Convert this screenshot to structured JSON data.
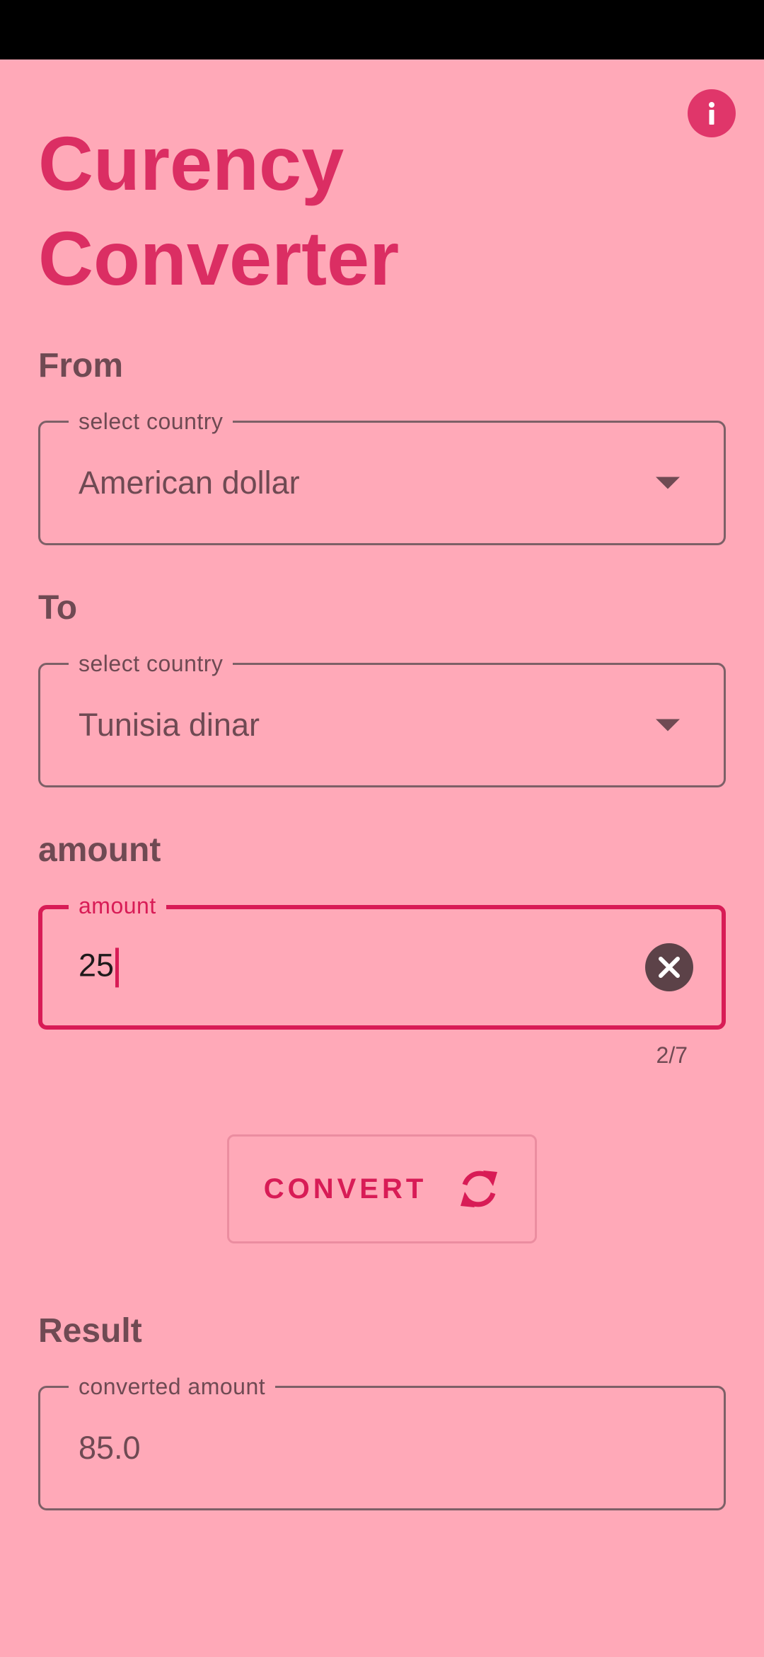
{
  "app": {
    "title_line1": "Curency",
    "title_line2": "Converter"
  },
  "from": {
    "label": "From",
    "legend": "select country",
    "value": "American dollar"
  },
  "to": {
    "label": "To",
    "legend": "select country",
    "value": "Tunisia dinar"
  },
  "amount": {
    "label": "amount",
    "legend": "amount",
    "value": "25",
    "counter": "2/7"
  },
  "convert": {
    "label": "CONVERT"
  },
  "result": {
    "label": "Result",
    "legend": "converted amount",
    "value": "85.0"
  },
  "icons": {
    "info": "info-icon",
    "dropdown": "arrow-drop-down-icon",
    "clear": "clear-icon",
    "refresh": "refresh-icon"
  },
  "colors": {
    "background": "#ffa9b8",
    "accent": "#db2e63",
    "focused_border": "#d81c56",
    "text_muted": "#6f4a53",
    "status_bar": "#000000"
  }
}
